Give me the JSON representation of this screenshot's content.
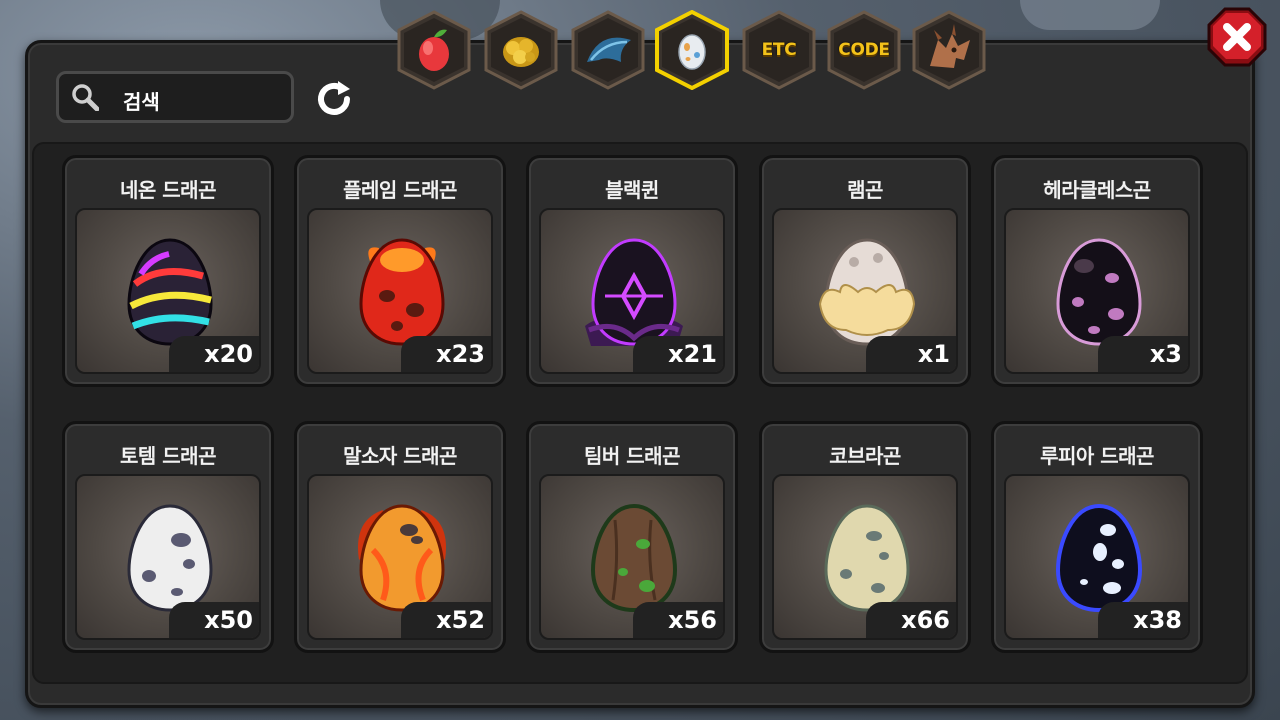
{
  "search": {
    "placeholder": "검색"
  },
  "tabs": [
    {
      "id": "fruit",
      "icon": "fruit-icon",
      "label": ""
    },
    {
      "id": "gold",
      "icon": "gold-icon",
      "label": ""
    },
    {
      "id": "feather",
      "icon": "feather-icon",
      "label": ""
    },
    {
      "id": "egg",
      "icon": "egg-icon",
      "label": "",
      "active": true
    },
    {
      "id": "etc",
      "icon": "",
      "label": "ETC"
    },
    {
      "id": "code",
      "icon": "",
      "label": "CODE"
    },
    {
      "id": "dragon",
      "icon": "dragon-icon",
      "label": ""
    }
  ],
  "items": [
    {
      "name": "네온 드래곤",
      "count": "x20",
      "egg": "neon"
    },
    {
      "name": "플레임 드래곤",
      "count": "x23",
      "egg": "flame"
    },
    {
      "name": "블랙퀸",
      "count": "x21",
      "egg": "blackqueen"
    },
    {
      "name": "램곤",
      "count": "x1",
      "egg": "lamb"
    },
    {
      "name": "헤라클레스곤",
      "count": "x3",
      "egg": "hercules"
    },
    {
      "name": "토템 드래곤",
      "count": "x50",
      "egg": "totem"
    },
    {
      "name": "말소자 드래곤",
      "count": "x52",
      "egg": "malsoja"
    },
    {
      "name": "팀버 드래곤",
      "count": "x56",
      "egg": "timber"
    },
    {
      "name": "코브라곤",
      "count": "x66",
      "egg": "cobra"
    },
    {
      "name": "루피아 드래곤",
      "count": "x38",
      "egg": "lupia"
    }
  ],
  "colors": {
    "tab_active_border": "#f3d000",
    "tab_border": "#6b5a4a",
    "close_red": "#d4202a"
  }
}
